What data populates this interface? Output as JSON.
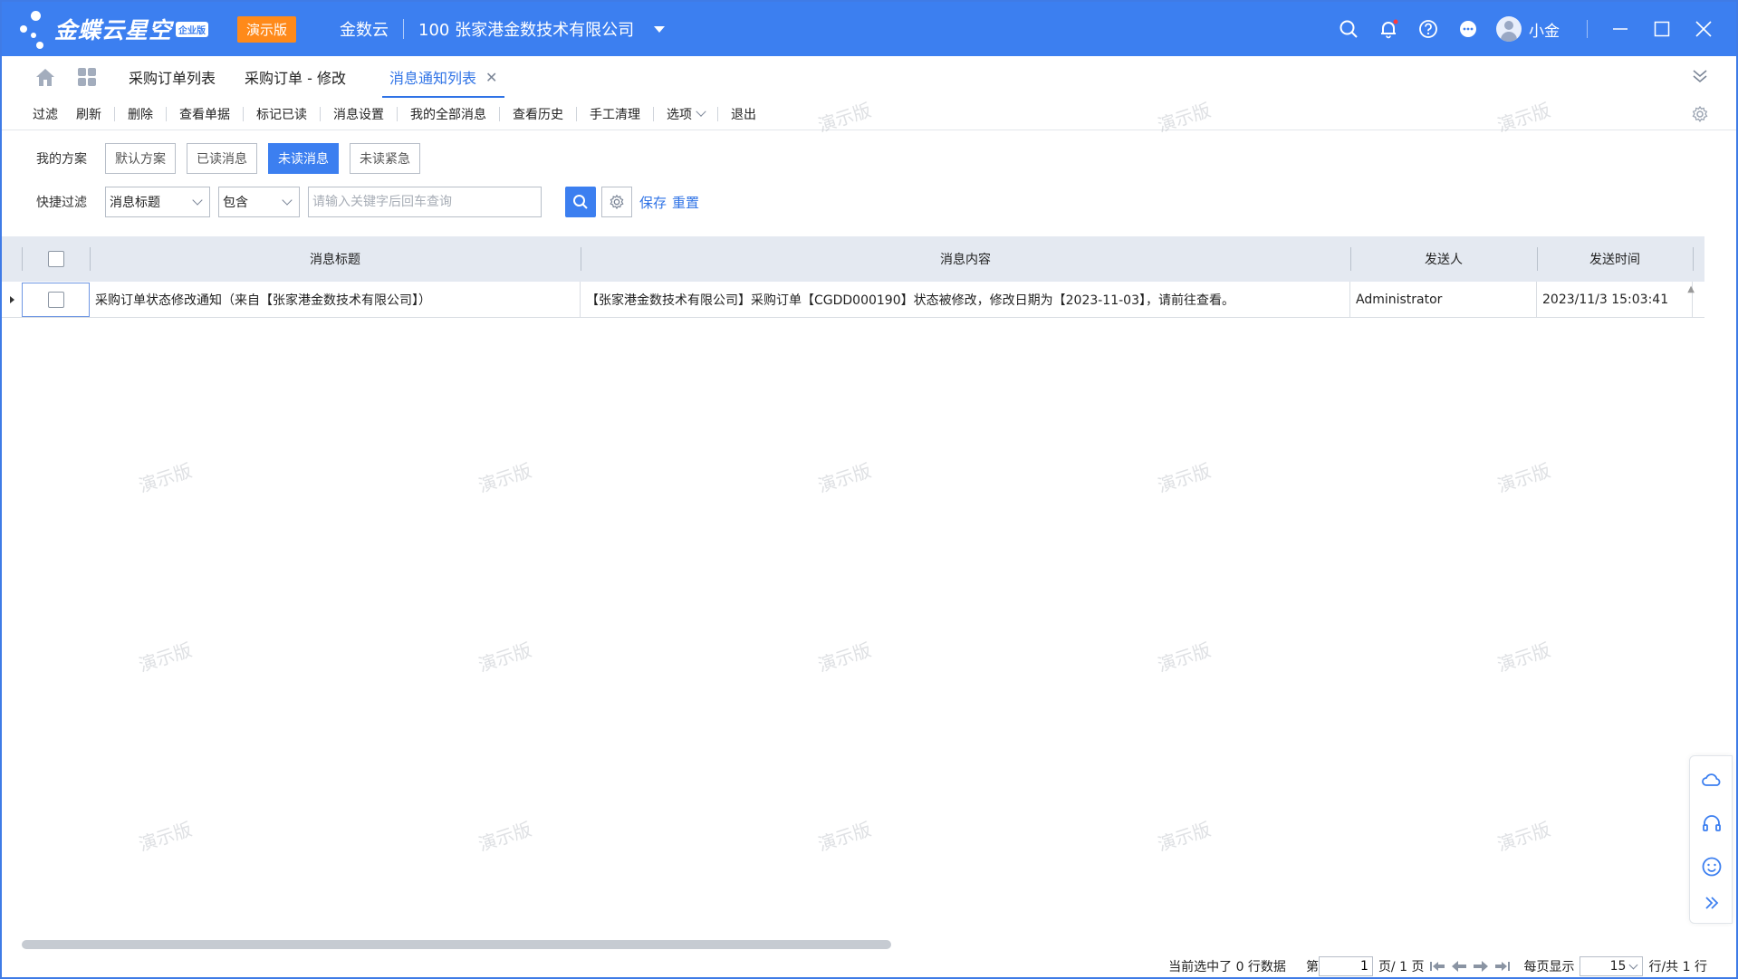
{
  "titlebar": {
    "logo_text": "金蝶云星空",
    "logo_badge": "企业版",
    "demo_badge": "演示版",
    "cloud_name": "金数云",
    "company": "100  张家港金数技术有限公司",
    "user_name": "小金",
    "brand_color": "#3c7ff0"
  },
  "tabs": [
    {
      "label": "采购订单列表",
      "active": false
    },
    {
      "label": "采购订单 - 修改",
      "active": false
    },
    {
      "label": "消息通知列表",
      "active": true
    }
  ],
  "toolbar": {
    "items": [
      "过滤",
      "刷新",
      "删除",
      "查看单据",
      "标记已读",
      "消息设置",
      "我的全部消息",
      "查看历史",
      "手工清理",
      "选项",
      "退出"
    ]
  },
  "filter": {
    "scheme_label": "我的方案",
    "schemes": [
      "默认方案",
      "已读消息",
      "未读消息",
      "未读紧急"
    ],
    "active_scheme": "未读消息",
    "quick_label": "快捷过滤",
    "field_value": "消息标题",
    "operator_value": "包含",
    "keyword_placeholder": "请输入关键字后回车查询",
    "save_label": "保存",
    "reset_label": "重置"
  },
  "grid": {
    "columns": [
      "消息标题",
      "消息内容",
      "发送人",
      "发送时间"
    ],
    "rows": [
      {
        "title": "采购订单状态修改通知（来自【张家港金数技术有限公司】）",
        "content": "【张家港金数技术有限公司】采购订单【CGDD000190】状态被修改，修改日期为【2023-11-03】，请前往查看。",
        "sender": "Administrator",
        "time": "2023/11/3 15:03:41"
      }
    ]
  },
  "watermark_text": "演示版",
  "pager": {
    "selected_text": "当前选中了 0 行数据",
    "page_prefix": "第",
    "page_value": "1",
    "page_suffix": "页/ 1 页",
    "per_page_label": "每页显示",
    "per_page_value": "15",
    "total_text": "行/共 1 行"
  }
}
